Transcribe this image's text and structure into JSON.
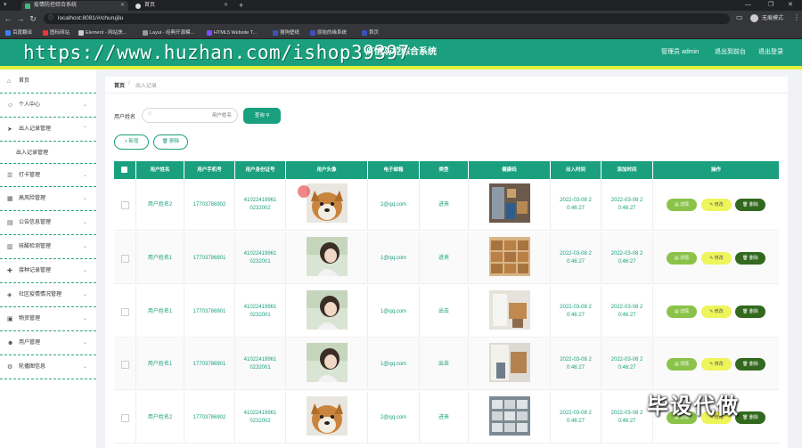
{
  "browser": {
    "tabs": [
      {
        "label": "疫情防控综合系统"
      },
      {
        "label": "首页"
      }
    ],
    "url": "localhost:8081/#/churujilu",
    "profile": "无痕模式",
    "bookmarks": [
      "百度翻译",
      "图标网站",
      "Element - 网站快...",
      "Layui - 经典开源模...",
      "HTML5 Website T...",
      "搜狗壁纸",
      "原始的缘系统",
      "首页"
    ]
  },
  "header": {
    "title": "疫情防控综合系统",
    "links": [
      "管理员 admin",
      "退出到前台",
      "退出登录"
    ]
  },
  "watermark": {
    "url": "https://www.huzhan.com/ishop39397",
    "corner": "毕设代做"
  },
  "sidebar": {
    "items": [
      {
        "label": "首页",
        "icon": "home-icon",
        "glyph": "⌂"
      },
      {
        "label": "个人中心",
        "icon": "user-icon",
        "glyph": "☺"
      },
      {
        "label": "出入记录管理",
        "icon": "send-icon",
        "glyph": "➤"
      },
      {
        "label": "出入记录管理",
        "icon": "",
        "glyph": ""
      },
      {
        "label": "打卡管理",
        "icon": "list-icon",
        "glyph": "☰"
      },
      {
        "label": "高风险管理",
        "icon": "grid-icon",
        "glyph": "▦"
      },
      {
        "label": "公告信息管理",
        "icon": "doc-icon",
        "glyph": "▤"
      },
      {
        "label": "核酸检测管理",
        "icon": "chart-icon",
        "glyph": "▥"
      },
      {
        "label": "接种记录管理",
        "icon": "inject-icon",
        "glyph": "✚"
      },
      {
        "label": "社区疫情情况管理",
        "icon": "community-icon",
        "glyph": "◈"
      },
      {
        "label": "物资管理",
        "icon": "box-icon",
        "glyph": "▣"
      },
      {
        "label": "用户管理",
        "icon": "people-icon",
        "glyph": "☻"
      },
      {
        "label": "轮播图信息",
        "icon": "settings-icon",
        "glyph": "⚙"
      }
    ]
  },
  "breadcrumb": {
    "home": "首页",
    "sep": "/",
    "current": "出入记录"
  },
  "search": {
    "label": "用户姓名",
    "placeholder": "用户姓名",
    "button": "查询"
  },
  "actions": {
    "add": "+ 新增",
    "delete": "删除"
  },
  "table": {
    "headers": [
      "",
      "用户姓名",
      "用户手机号",
      "用户身份证号",
      "用户头像",
      "电子邮箱",
      "类型",
      "健康码",
      "出入时间",
      "添加时间",
      "操作"
    ],
    "rows": [
      {
        "name": "用户姓名2",
        "phone": "17703786902",
        "idcard": "41022419961\n0232002",
        "avatar": "dog",
        "email": "2@qq.com",
        "type": "进来",
        "health": "shelf",
        "out": "2022-03-08 2\n0:46:27",
        "add": "2022-03-08 2\n0:46:27"
      },
      {
        "name": "用户姓名1",
        "phone": "17703786901",
        "idcard": "41022419961\n0232001",
        "avatar": "girl",
        "email": "1@qq.com",
        "type": "进来",
        "health": "boxes",
        "out": "2022-03-08 2\n0:46:27",
        "add": "2022-03-08 2\n0:46:27"
      },
      {
        "name": "用户姓名1",
        "phone": "17703786901",
        "idcard": "41022419961\n0232001",
        "avatar": "girl",
        "email": "1@qq.com",
        "type": "出去",
        "health": "room",
        "out": "2022-03-08 2\n0:46:27",
        "add": "2022-03-08 2\n0:46:27"
      },
      {
        "name": "用户姓名1",
        "phone": "17703786901",
        "idcard": "41022419961\n0232001",
        "avatar": "girl",
        "email": "1@qq.com",
        "type": "出去",
        "health": "room2",
        "out": "2022-03-08 2\n0:46:27",
        "add": "2022-03-08 2\n0:46:27"
      },
      {
        "name": "用户姓名2",
        "phone": "17703786902",
        "idcard": "41022419961\n0232002",
        "avatar": "dog",
        "email": "2@qq.com",
        "type": "进来",
        "health": "crates",
        "out": "2022-03-08 2\n0:46:27",
        "add": "2022-03-08 2\n0:46:27"
      }
    ],
    "row_actions": {
      "detail": "详情",
      "edit": "修改",
      "delete": "删除"
    }
  },
  "colors": {
    "accent": "#1aa07e",
    "yellow": "#eef55a",
    "lime": "#8bc34a",
    "darkgreen": "#33691e"
  }
}
